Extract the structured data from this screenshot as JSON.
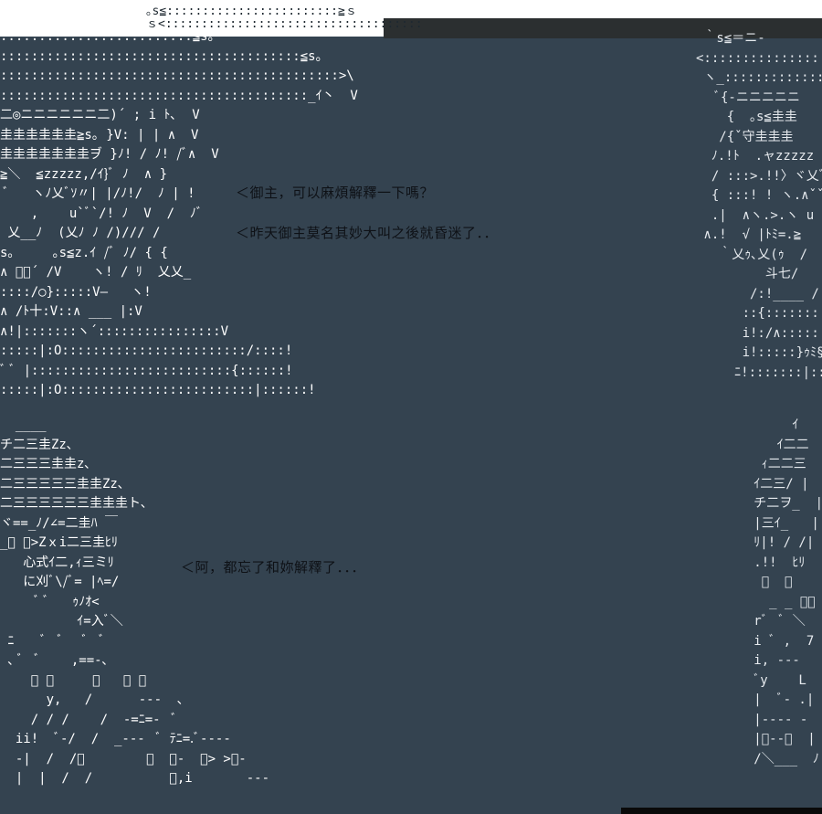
{
  "panel_top": {
    "top_fragment": "｡s≦::::::::::::::::::::::::≧ｓ\nｓ<::::::::::::::::::::::::::::::::::::",
    "left_figure": ":::::::::::::::::::::::::≦s｡\n:::::::::::::::::::::::::::::::::::::::≦s｡\n::::::::::::::::::::::::::::::::::::::::::::>\\\n::::::::::::::::::::::::::::::::::::::::_ｲ丶  V\n二◎ニニニニニニ二)´ ; i ﾄ､  V\n圭圭圭圭圭圭≧s｡ }V: | | ∧  V\n圭圭圭圭圭圭圭ヺ }ﾉ! / ﾉ! /ﾞ∧  V\n≧＼  ≦zzzzz,/ｲ}ﾞ ﾉ  ∧ }\n ﾞ   ヽﾉ乂ﾞｿ〃| |/ﾉ!/  ﾉ | !\n    ,    u`ﾞ`/! ﾉ  V  /  ﾉﾞ\n 乂__ﾉ  (乂ﾉ ﾉ /)/// /\ns｡     ｡s≦z.ｲ /ﾞ ﾉ/ { {\n∧ ﾞﾞ´ /V    ヽ! / ﾘ  乂乂_\n::::/○}:::::V―   ヽ!\n∧ /ﾄ十:V::∧ ___ |:V\n∧!|:::::::ヽ´::::::::::::::::V\n:::::|:O::::::::::::::::::::::::/::::!\nﾞ ﾞ |::::::::::::::::::::::::::{::::::!\n:::::|:O:::::::::::::::::::::::::|::::::!",
    "right_figure": " ｀s≦＝ニ-\n<:::::::::::::::::::::::::::::\n ヽ_::::::::::::::::::::::\n   ﾞ{-ニニニニニ\n    {  ｡s≦圭圭\n   /{ˇ守圭圭圭\n  ﾉ.!ﾄ  .ャzzzzz\n  / :::>.!!〉ヾ乂ﾞ\n  { :::! ! ヽ.∧ˇˇˇˇ\n  .|  ∧ヽ.>.ヽ u\n ∧.!  √ |ﾄﾐ=.≧\n   ｀乂ｩ､乂(ｩ  /\n         斗七/\n       /:!____ /\n      ::{:::::::::::::\n      i!:/∧::::::::::::\n      i!:::::}ｩﾐ§ｺ\n     ﾆ!:::::::|::::::::::::"
  },
  "panel_bottom": {
    "left_figure": "  ____\nチ二三圭Zz､\n二三三三圭圭z､\n二三三三三三圭圭Zz､\n二三三三三三三圭圭圭ト､\nヾ==_ﾉ/∠=二圭ﾊ ￣\n_ﾞ ､>Zｘi二三圭ﾋﾘ\n   心式ｲ二,ｨ三ミﾘ\n   に刈ﾞ\\/ﾞ= |ﾍ=/\n     ﾞ ﾞ   ｩﾉｵ<\n          ｲ=入ﾞ＼\n ﾆ    ﾞ  ﾞ   ﾞ  ﾞ\n ､ ﾞ  ﾞ    ,==-､\n    ﾞ ､     ﾞ   ﾞ ､\n      y,   /      ---  ､\n    / / /    /  -=ﾆ=-  ﾞ\n  ii!  ﾞ-/  /  _---  ﾞ ﾃﾆ=.ﾞ----\n  -|  /  /ﾞ        ﾞ  ﾞ-  ＼> >ﾞ-\n  |  |  /  /          ﾞ,i       ---",
    "right_figure": "        ｲ\n      ｲ二二\n    ｨ二二三\n   ｲ二三/ |\n   チ二ヲ_  |\n   |三ｲ_   |\n   ﾘ|! / /|\n   .!!  ﾋﾘ\n    ﾞ  ､\n     _ _ ﾞ､\n   rﾞ  ﾞ ＼\n   i ﾞ ,  7\n   i, ---   |\n   ﾞy    L\n   |  ﾞ- .|\n   |---- -  |\n   |ﾞ--ﾞ  |\n   /＼___  ﾉ"
  },
  "dialogue": {
    "line1": "＜御主，可以麻煩解釋一下嗎？",
    "line2": "＜昨天御主莫名其妙大叫之後就昏迷了．．",
    "line3": "＜阿，都忘了和妳解釋了．．．"
  },
  "colors": {
    "background": "#344350",
    "art": "#ffffff",
    "text": "#0e1116"
  }
}
